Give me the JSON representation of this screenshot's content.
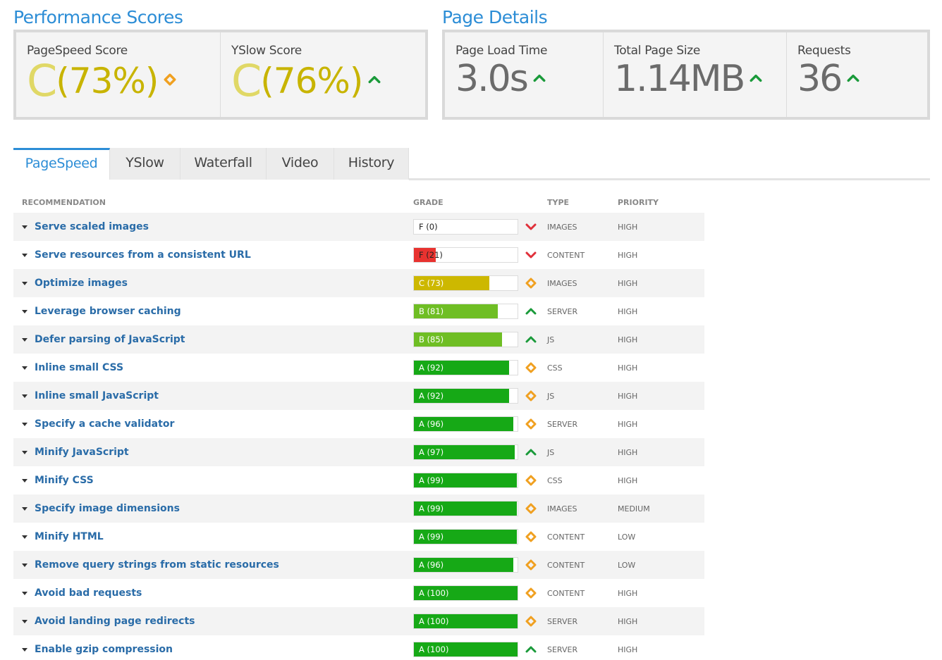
{
  "performance": {
    "title": "Performance Scores",
    "pagespeed": {
      "label": "PageSpeed Score",
      "grade": "C",
      "pct": "(73%)",
      "trend": "same"
    },
    "yslow": {
      "label": "YSlow Score",
      "grade": "C",
      "pct": "(76%)",
      "trend": "up"
    }
  },
  "page_details": {
    "title": "Page Details",
    "load_time": {
      "label": "Page Load Time",
      "value": "3.0s",
      "trend": "up"
    },
    "page_size": {
      "label": "Total Page Size",
      "value": "1.14MB",
      "trend": "up"
    },
    "requests": {
      "label": "Requests",
      "value": "36",
      "trend": "up"
    }
  },
  "tabs": [
    {
      "label": "PageSpeed",
      "active": true
    },
    {
      "label": "YSlow",
      "active": false
    },
    {
      "label": "Waterfall",
      "active": false
    },
    {
      "label": "Video",
      "active": false
    },
    {
      "label": "History",
      "active": false
    }
  ],
  "table": {
    "headers": {
      "recommendation": "RECOMMENDATION",
      "grade": "GRADE",
      "type": "TYPE",
      "priority": "PRIORITY"
    },
    "rows": [
      {
        "label": "Serve scaled images",
        "grade": "F (0)",
        "score": 0,
        "trend": "down",
        "type": "IMAGES",
        "priority": "HIGH"
      },
      {
        "label": "Serve resources from a consistent URL",
        "grade": "F (21)",
        "score": 21,
        "trend": "down",
        "type": "CONTENT",
        "priority": "HIGH"
      },
      {
        "label": "Optimize images",
        "grade": "C (73)",
        "score": 73,
        "trend": "same",
        "type": "IMAGES",
        "priority": "HIGH"
      },
      {
        "label": "Leverage browser caching",
        "grade": "B (81)",
        "score": 81,
        "trend": "up",
        "type": "SERVER",
        "priority": "HIGH"
      },
      {
        "label": "Defer parsing of JavaScript",
        "grade": "B (85)",
        "score": 85,
        "trend": "up",
        "type": "JS",
        "priority": "HIGH"
      },
      {
        "label": "Inline small CSS",
        "grade": "A (92)",
        "score": 92,
        "trend": "same",
        "type": "CSS",
        "priority": "HIGH"
      },
      {
        "label": "Inline small JavaScript",
        "grade": "A (92)",
        "score": 92,
        "trend": "same",
        "type": "JS",
        "priority": "HIGH"
      },
      {
        "label": "Specify a cache validator",
        "grade": "A (96)",
        "score": 96,
        "trend": "same",
        "type": "SERVER",
        "priority": "HIGH"
      },
      {
        "label": "Minify JavaScript",
        "grade": "A (97)",
        "score": 97,
        "trend": "up",
        "type": "JS",
        "priority": "HIGH"
      },
      {
        "label": "Minify CSS",
        "grade": "A (99)",
        "score": 99,
        "trend": "same",
        "type": "CSS",
        "priority": "HIGH"
      },
      {
        "label": "Specify image dimensions",
        "grade": "A (99)",
        "score": 99,
        "trend": "same",
        "type": "IMAGES",
        "priority": "MEDIUM"
      },
      {
        "label": "Minify HTML",
        "grade": "A (99)",
        "score": 99,
        "trend": "same",
        "type": "CONTENT",
        "priority": "LOW"
      },
      {
        "label": "Remove query strings from static resources",
        "grade": "A (96)",
        "score": 96,
        "trend": "same",
        "type": "CONTENT",
        "priority": "LOW"
      },
      {
        "label": "Avoid bad requests",
        "grade": "A (100)",
        "score": 100,
        "trend": "same",
        "type": "CONTENT",
        "priority": "HIGH"
      },
      {
        "label": "Avoid landing page redirects",
        "grade": "A (100)",
        "score": 100,
        "trend": "same",
        "type": "SERVER",
        "priority": "HIGH"
      },
      {
        "label": "Enable gzip compression",
        "grade": "A (100)",
        "score": 100,
        "trend": "up",
        "type": "SERVER",
        "priority": "HIGH"
      }
    ]
  },
  "colors": {
    "accent": "#2c8dd6",
    "grade_f": "#e8322f",
    "grade_c": "#cdb800",
    "grade_b": "#6fbe24",
    "grade_a": "#16a916",
    "trend_up": "#1a9a3a",
    "trend_down": "#e0303a",
    "trend_same": "#f0a020"
  },
  "icons": {
    "trend_up": "chevron-up-icon",
    "trend_down": "chevron-down-icon",
    "trend_same": "diamond-icon"
  }
}
